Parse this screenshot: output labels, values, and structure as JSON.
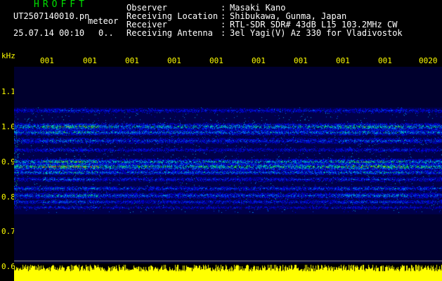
{
  "header": {
    "title": "HROFFT",
    "file_name": "UT2507140010.pn",
    "meteor_label": "meteor",
    "datetime": "25.07.14 00:10",
    "datetime_extra": "0.."
  },
  "info": [
    {
      "label": "Observer",
      "value": "Masaki Kano"
    },
    {
      "label": "Receiving Location",
      "value": "Shibukawa, Gunma, Japan"
    },
    {
      "label": "Receiver",
      "value": "RTL-SDR SDR# 43dB L15 103.2MHz CW"
    },
    {
      "label": "Receiving Antenna",
      "value": "3el Yagi(V) Az 330 for Vladivostok"
    }
  ],
  "axes": {
    "y_unit": "kHz",
    "y_ticks": [
      "1.1",
      "1.0",
      "0.9",
      "0.8",
      "0.7",
      "0.6"
    ],
    "x_ticks": [
      "001",
      "001",
      "001",
      "001",
      "001",
      "001",
      "001",
      "001",
      "001",
      "0020"
    ]
  },
  "colors": {
    "background": "#000000",
    "spectrogram_bg": "#00004a",
    "axis_text": "#ffff00",
    "title_text": "#00e000",
    "activity": "#ffff00"
  }
}
